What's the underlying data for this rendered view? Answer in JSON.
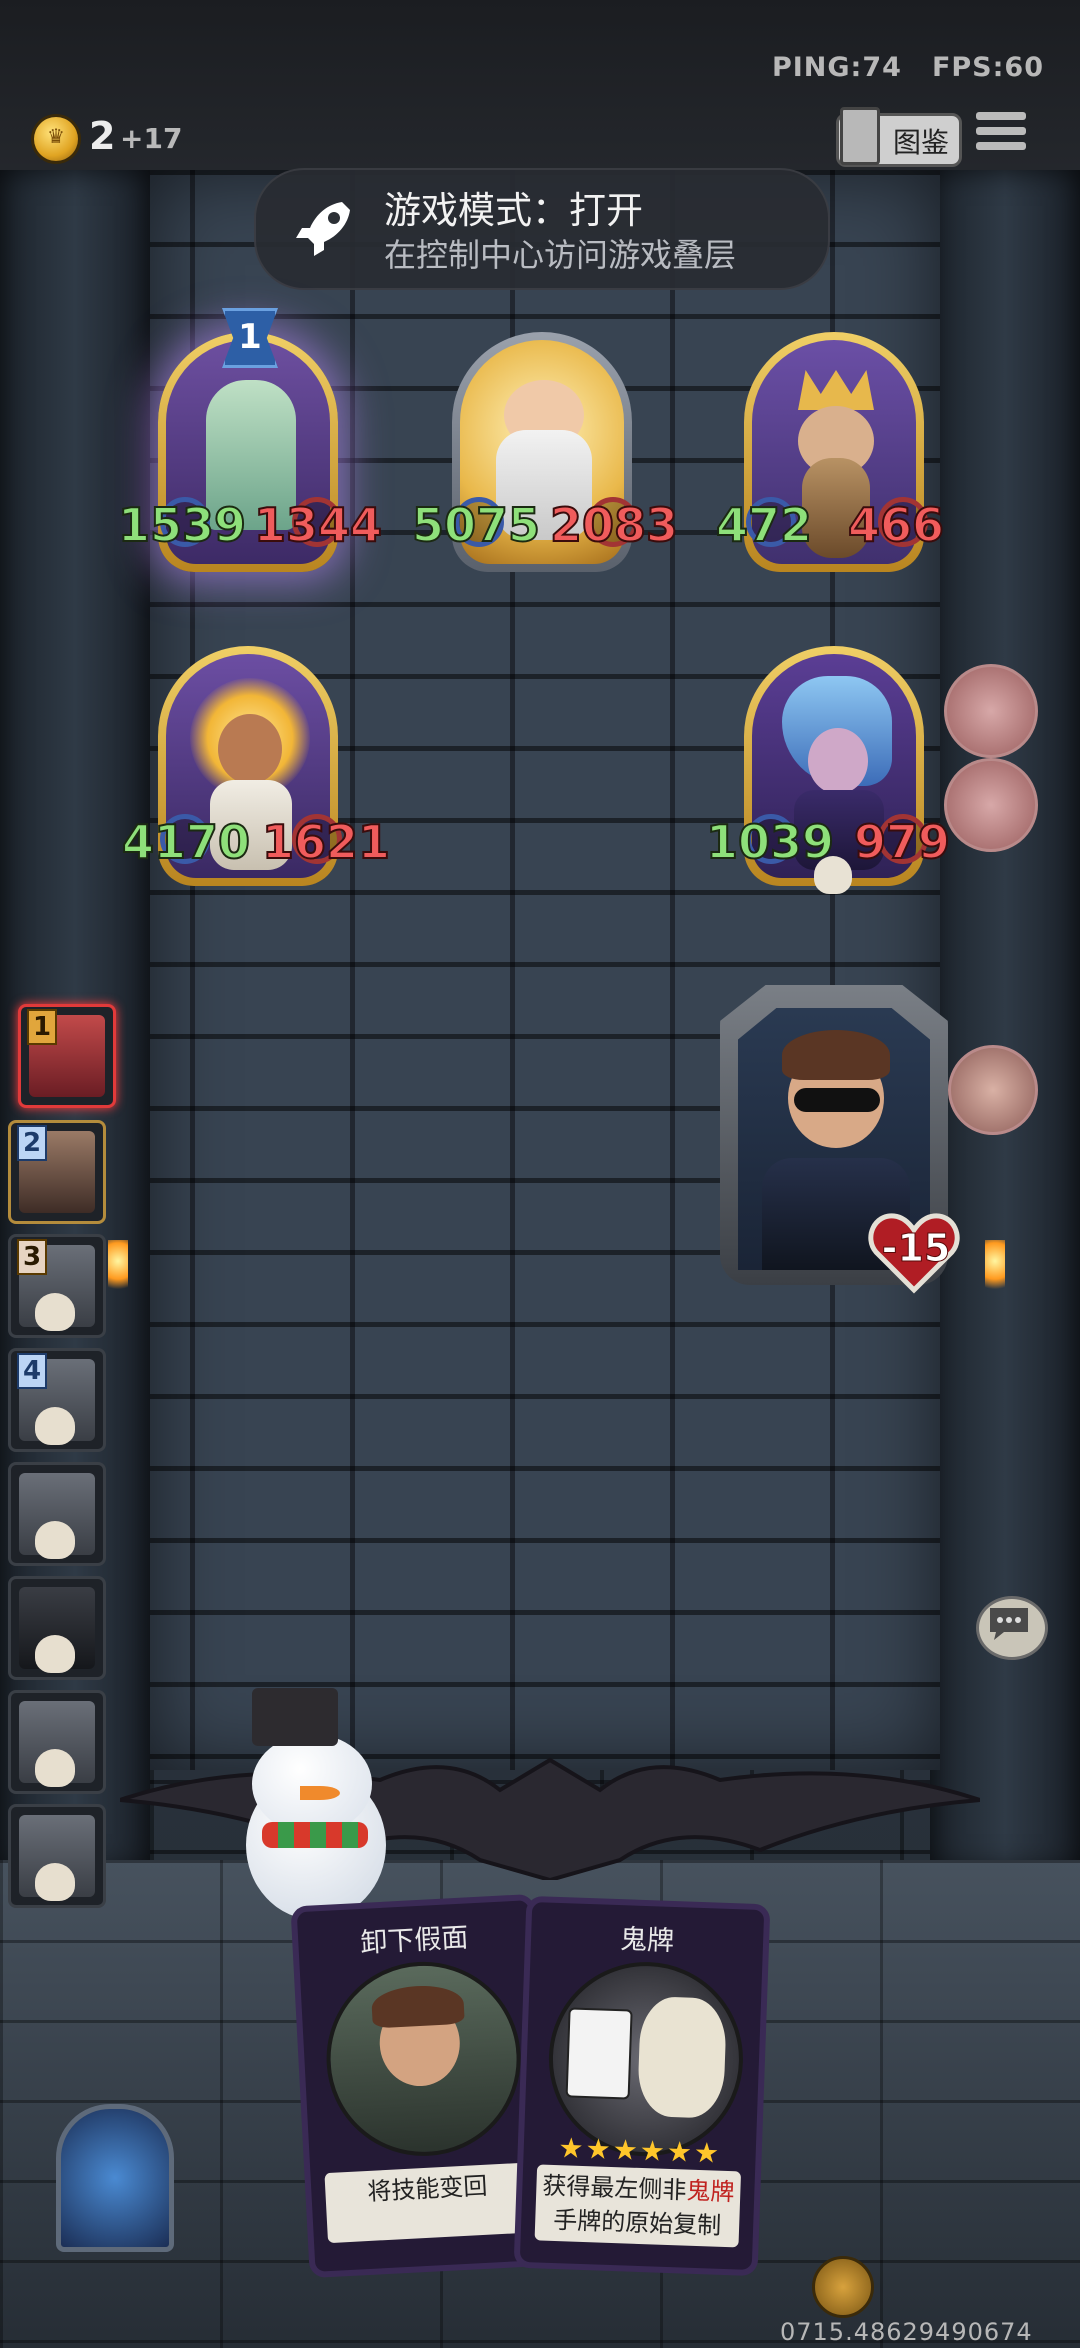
{
  "hud": {
    "ping": "PING:74",
    "fps": "FPS:60",
    "gold": "2",
    "gold_gain": "+17",
    "codex_label": "图鉴"
  },
  "notification": {
    "title": "游戏模式：打开",
    "subtitle": "在控制中心访问游戏叠层"
  },
  "heroes": [
    {
      "atk": "1539",
      "hp": "1344",
      "rank": "1"
    },
    {
      "atk": "5075",
      "hp": "2083"
    },
    {
      "atk": "472",
      "hp": "466"
    },
    {
      "atk": "4170",
      "hp": "1621"
    },
    {
      "atk": "1039",
      "hp": "979"
    }
  ],
  "player": {
    "health_change": "-15"
  },
  "turn_order": [
    "1",
    "2",
    "3",
    "4"
  ],
  "hand": [
    {
      "title": "卸下假面",
      "text": "将技能变回"
    },
    {
      "title": "鬼牌",
      "text_before": "获得最左侧非",
      "text_highlight": "鬼牌",
      "text_after": "手牌的原始复制",
      "stars": "★★★★★★"
    }
  ],
  "footer": {
    "version": "0715.48629490674"
  }
}
